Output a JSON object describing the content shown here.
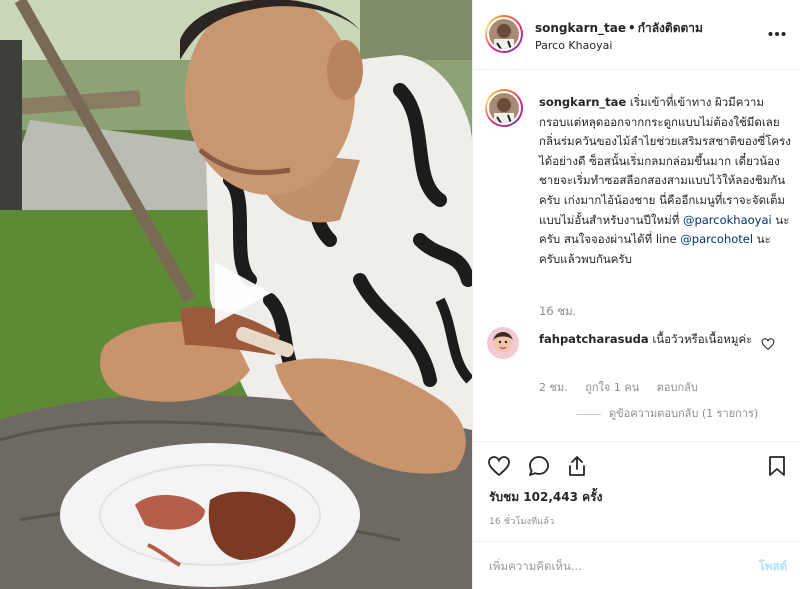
{
  "post": {
    "username": "songkarn_tae",
    "follow_text": "กำลังติดตาม",
    "location": "Parco Khaoyai"
  },
  "caption": {
    "username": "songkarn_tae",
    "text_1": "เริ่มเข้าที่เข้าทาง ผิวมีความกรอบแต่หลุดออกจากกระดูกแบบไม่ต้องใช้มีดเลย กลิ่นร่มควันของไม้ลำไยช่วยเสริมรสชาติของซี่โครงได้อย่างดี ซ็อสนั้นเริ่มกลมกล่อมขึ้นมาก เดี๋ยวน้องชายจะเริ่มทำซอสลีอกสองสามแบบไว้ให้ลองชิมกันครับ เก่งมากไอ้น้องชาย นี่คืออีกเมนูที่เราจะจัดเต็มแบบไม่อั้นสำหรับงานปีใหม่ที่",
    "mention_1": "@parcokhaoyai",
    "text_2": "นะครับ สนใจจองผ่านได้ที่ line",
    "mention_2": "@parcohotel",
    "text_3": "นะครับแล้วพบกันครับ",
    "time": "16 ชม."
  },
  "comment": {
    "username": "fahpatcharasuda",
    "text": "เนื้อวัวหรือเนื้อหมูค่ะ",
    "time": "2 ชม.",
    "likes": "ถูกใจ 1 คน",
    "reply": "ตอบกลับ",
    "view_replies": "ดูข้อความตอบกลับ (1 รายการ)"
  },
  "stats": {
    "views": "รับชม 102,443 ครั้ง",
    "time_ago": "16 ชั่วโมงที่แล้ว"
  },
  "input": {
    "placeholder": "เพิ่มความคิดเห็น...",
    "post_label": "โพสต์"
  },
  "icons": {
    "more": "more-horizontal-icon",
    "heart": "heart-icon",
    "comment": "comment-icon",
    "share": "share-icon",
    "save": "bookmark-icon",
    "play": "play-icon"
  },
  "colors": {
    "link": "#003569",
    "muted": "#8e8e8e",
    "post_button_disabled": "#b2dffc",
    "text": "#262626"
  }
}
